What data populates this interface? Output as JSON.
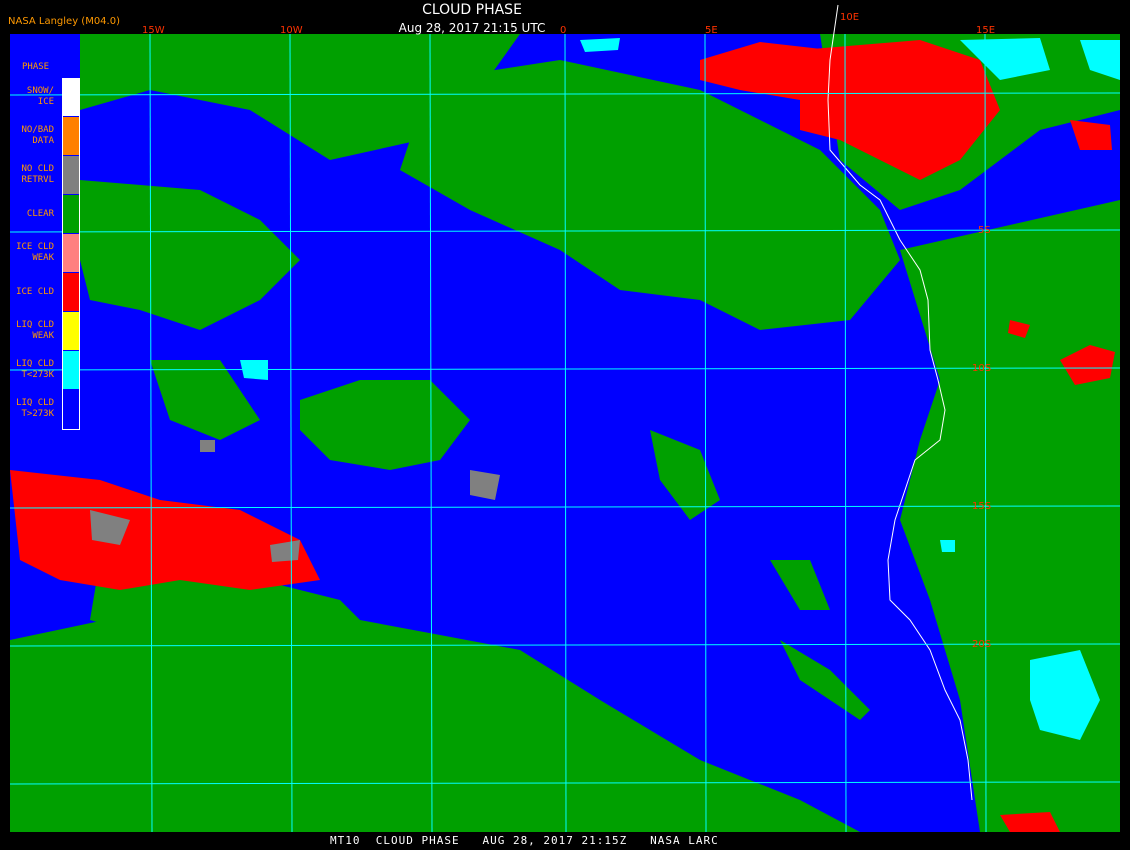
{
  "header": {
    "credit": "NASA Langley (M04.0)",
    "title": "CLOUD PHASE",
    "subtitle": "Aug 28, 2017 21:15 UTC"
  },
  "legend": {
    "title": "PHASE",
    "items": [
      {
        "label": "SNOW/\nICE",
        "color": "#ffffff"
      },
      {
        "label": "NO/BAD\nDATA",
        "color": "#ff8000"
      },
      {
        "label": "NO CLD\nRETRVL",
        "color": "#808080"
      },
      {
        "label": "CLEAR",
        "color": "#00a000"
      },
      {
        "label": "ICE CLD\nWEAK",
        "color": "#ff8080"
      },
      {
        "label": "ICE CLD",
        "color": "#ff0000"
      },
      {
        "label": "LIQ CLD\nWEAK",
        "color": "#ffff00"
      },
      {
        "label": "LIQ CLD\nT<273K",
        "color": "#00ffff"
      },
      {
        "label": "LIQ CLD\nT>273K",
        "color": "#0000ff"
      }
    ]
  },
  "grid": {
    "lon_labels": [
      "15W",
      "10W",
      "0",
      "5E",
      "10E",
      "15E"
    ],
    "lat_labels": [
      "5S",
      "10S",
      "15S",
      "20S"
    ]
  },
  "colors": {
    "liq_warm": "#0000ff",
    "clear": "#00a000",
    "ice": "#ff0000",
    "liq_cold": "#00ffff",
    "no_retrieval": "#808080",
    "grid": "#00ffff",
    "grid_label": "#ff3300",
    "coast": "#ffffff"
  },
  "footer": "MT10  CLOUD PHASE   AUG 28, 2017 21:15Z   NASA LARC"
}
